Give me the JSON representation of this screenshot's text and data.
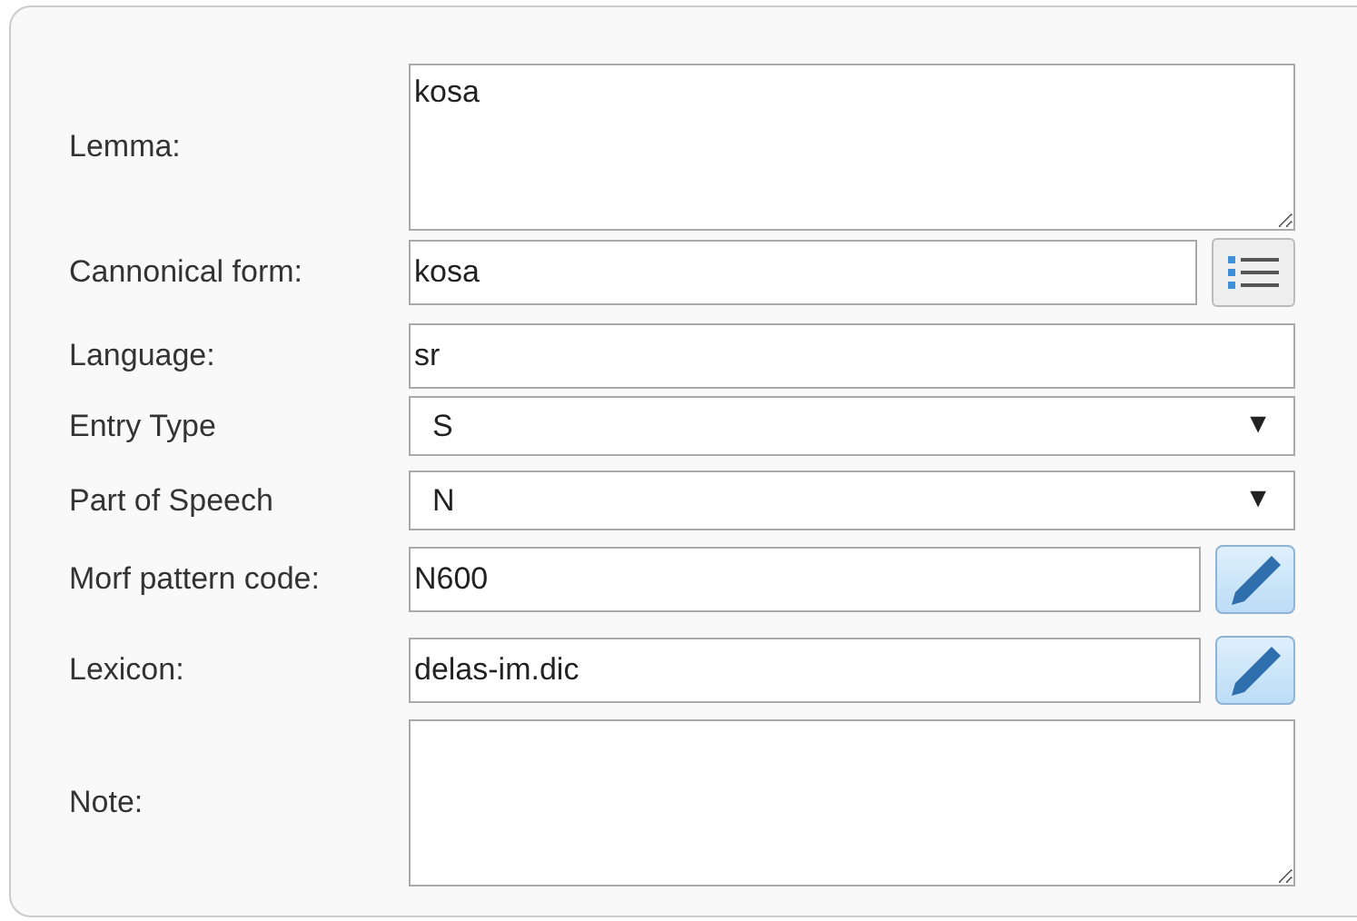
{
  "fields": [
    {
      "label": "Lemma:",
      "kind": "textarea",
      "value": "kosa"
    },
    {
      "label": "Cannonical form:",
      "kind": "text",
      "value": "kosa",
      "button": {
        "kind": "list"
      }
    },
    {
      "label": "Language:",
      "kind": "text",
      "value": "sr"
    },
    {
      "label": "Entry Type",
      "kind": "select",
      "value": "S",
      "arrow": "▼"
    },
    {
      "label": "Part of Speech",
      "kind": "select",
      "value": "N",
      "arrow": "▼"
    },
    {
      "label": "Morf pattern code:",
      "kind": "text",
      "value": "N600",
      "button": {
        "kind": "edit"
      }
    },
    {
      "label": "Lexicon:",
      "kind": "text",
      "value": "delas-im.dic",
      "button": {
        "kind": "edit"
      }
    },
    {
      "label": "Note:",
      "kind": "textarea"
    }
  ]
}
